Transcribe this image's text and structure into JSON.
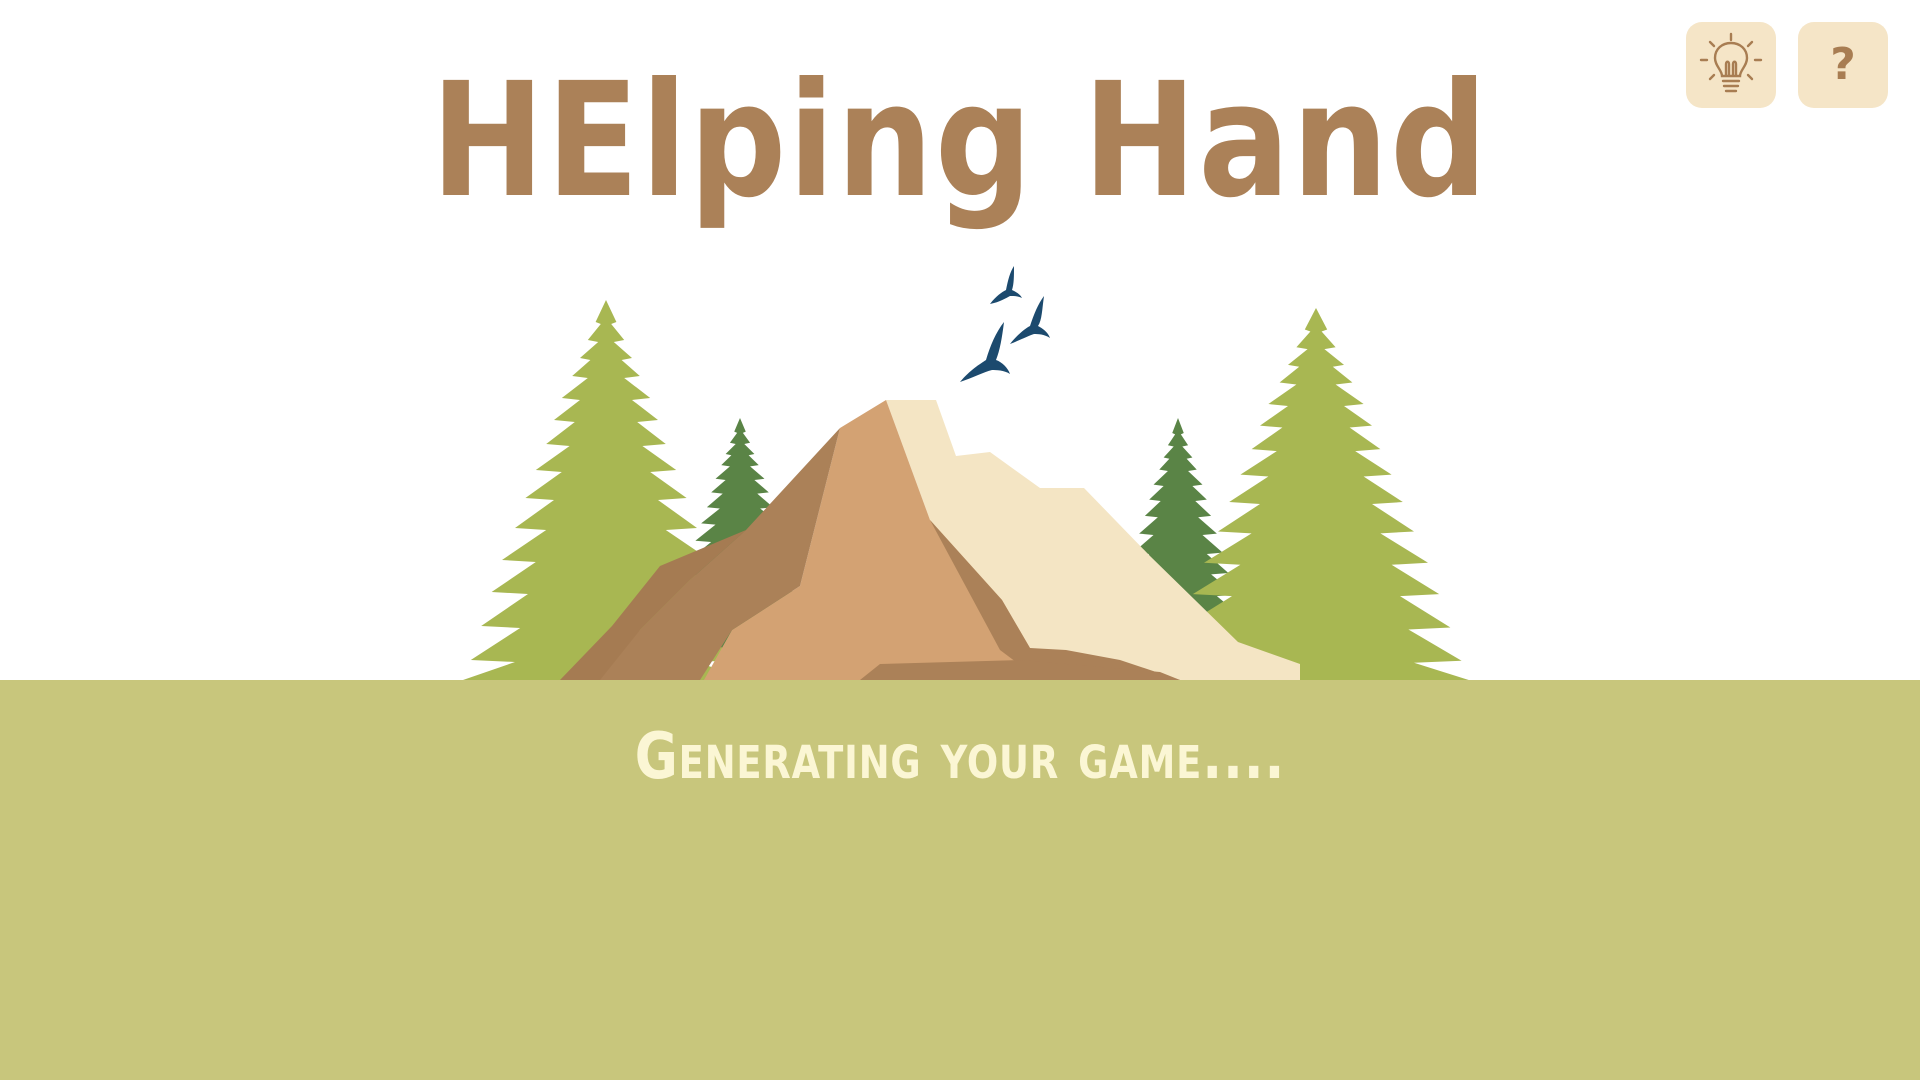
{
  "title": "HElping Hand",
  "status": "Generating your game....",
  "toolbar": {
    "hint_icon": "lightbulb-icon",
    "help_label": "?"
  },
  "colors": {
    "title": "#ab8158",
    "button_bg": "#f5e5c7",
    "ground": "#c8c67c",
    "status_text": "#fbf6d4",
    "tree_light": "#a8b752",
    "tree_dark": "#5a8446",
    "mountain_mid": "#d3a273",
    "mountain_shadow": "#ab8158",
    "mountain_snow": "#f4e5c4",
    "bird": "#1c4a6e"
  }
}
